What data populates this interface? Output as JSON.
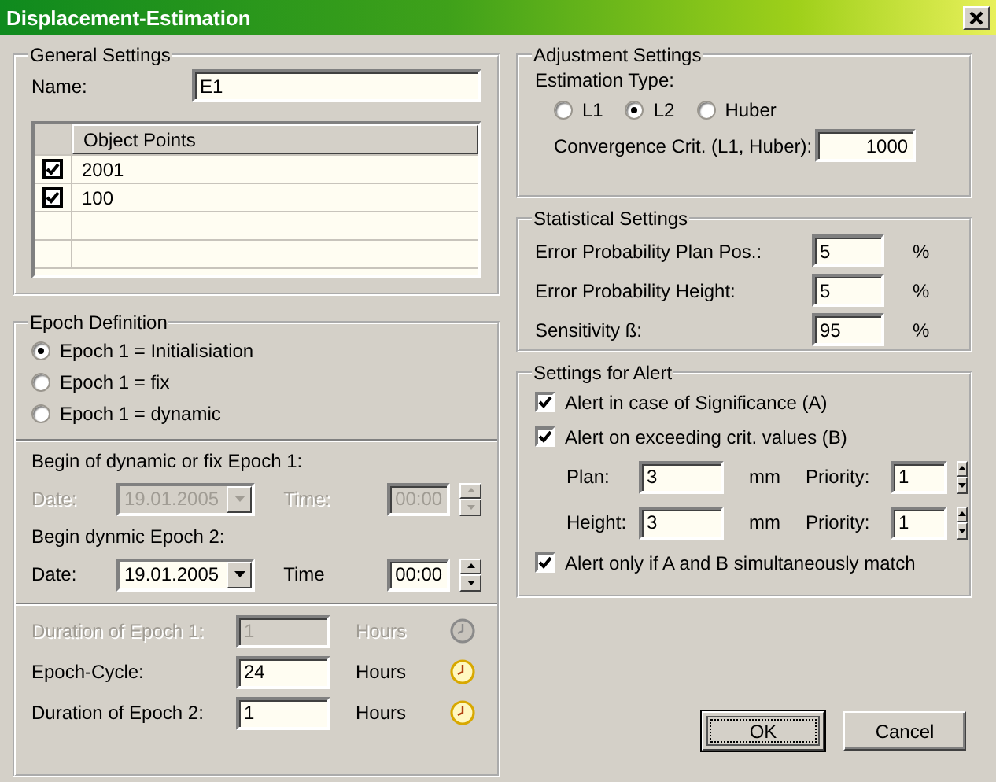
{
  "window": {
    "title": "Displacement-Estimation"
  },
  "general_settings": {
    "title": "General Settings",
    "name_label": "Name:",
    "name_value": "E1",
    "table": {
      "columns": [
        "Object Points"
      ],
      "rows": [
        {
          "checked": true,
          "point": "2001"
        },
        {
          "checked": true,
          "point": "100"
        }
      ]
    }
  },
  "epoch_definition": {
    "title": "Epoch Definition",
    "options": [
      {
        "label": "Epoch 1 = Initialisiation",
        "selected": true
      },
      {
        "label": "Epoch 1 = fix",
        "selected": false
      },
      {
        "label": "Epoch 1 = dynamic",
        "selected": false
      }
    ],
    "begins": [
      {
        "title": "Begin of dynamic or fix Epoch 1:",
        "disabled": true,
        "date_label": "Date:",
        "date": "19.01.2005",
        "time_label": "Time:",
        "time": "00:00"
      },
      {
        "title": "Begin dynmic Epoch 2:",
        "disabled": false,
        "date_label": "Date:",
        "date": "19.01.2005",
        "time_label": "Time",
        "time": "00:00"
      }
    ],
    "durations": [
      {
        "label": "Duration of Epoch 1:",
        "value": "1",
        "unit": "Hours",
        "disabled": true
      },
      {
        "label": "Epoch-Cycle:",
        "value": "24",
        "unit": "Hours",
        "disabled": false
      },
      {
        "label": "Duration of Epoch 2:",
        "value": "1",
        "unit": "Hours",
        "disabled": false
      }
    ]
  },
  "adjustment_settings": {
    "title": "Adjustment Settings",
    "estimation_label": "Estimation Type:",
    "options": [
      {
        "label": "L1",
        "selected": false
      },
      {
        "label": "L2",
        "selected": true
      },
      {
        "label": "Huber",
        "selected": false
      }
    ],
    "convergence_label": "Convergence Crit. (L1, Huber):",
    "convergence_value": "1000"
  },
  "statistical_settings": {
    "title": "Statistical Settings",
    "rows": [
      {
        "label": "Error Probability Plan Pos.:",
        "value": "5",
        "unit": "%"
      },
      {
        "label": "Error Probability Height:",
        "value": "5",
        "unit": "%"
      },
      {
        "label": "Sensitivity ß:",
        "value": "95",
        "unit": "%"
      }
    ]
  },
  "alert_settings": {
    "title": "Settings for Alert",
    "items": [
      {
        "kind": "check",
        "label": "Alert in case of Significance (A)",
        "checked": true
      },
      {
        "kind": "check",
        "label": "Alert on exceeding crit. values (B)",
        "checked": true
      },
      {
        "kind": "limit",
        "label": "Plan:",
        "value": "3",
        "unit": "mm",
        "priority_label": "Priority:",
        "priority": "1"
      },
      {
        "kind": "limit",
        "label": "Height:",
        "value": "3",
        "unit": "mm",
        "priority_label": "Priority:",
        "priority": "1"
      },
      {
        "kind": "check",
        "label": "Alert only if A and B simultaneously match",
        "checked": true
      }
    ]
  },
  "buttons": [
    {
      "label": "OK",
      "focused": true
    },
    {
      "label": "Cancel",
      "focused": false
    }
  ]
}
